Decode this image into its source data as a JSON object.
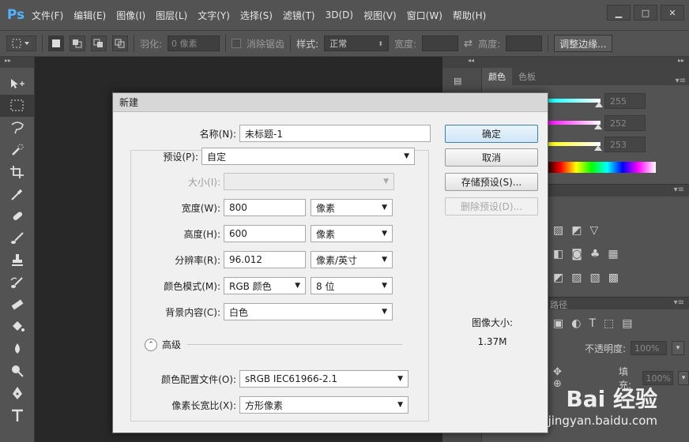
{
  "menubar": {
    "logo": "Ps",
    "items": [
      "文件(F)",
      "编辑(E)",
      "图像(I)",
      "图层(L)",
      "文字(Y)",
      "选择(S)",
      "滤镜(T)",
      "3D(D)",
      "视图(V)",
      "窗口(W)",
      "帮助(H)"
    ],
    "controls": [
      "▁",
      "□",
      "✕"
    ]
  },
  "optionsbar": {
    "feather_label": "羽化:",
    "feather_value": "0 像素",
    "antialias_label": "消除锯齿",
    "style_label": "样式:",
    "style_value": "正常",
    "width_label": "宽度:",
    "height_label": "高度:",
    "refine_edge": "调整边缘..."
  },
  "dialog": {
    "title": "新建",
    "name_label": "名称(N):",
    "name_value": "未标题-1",
    "preset_label": "预设(P):",
    "preset_value": "自定",
    "size_label": "大小(I):",
    "size_value": "",
    "width_label": "宽度(W):",
    "width_value": "800",
    "width_unit": "像素",
    "height_label": "高度(H):",
    "height_value": "600",
    "height_unit": "像素",
    "resolution_label": "分辨率(R):",
    "resolution_value": "96.012",
    "resolution_unit": "像素/英寸",
    "colormode_label": "颜色模式(M):",
    "colormode_value": "RGB 颜色",
    "bitdepth_value": "8 位",
    "bg_label": "背景内容(C):",
    "bg_value": "白色",
    "advanced_label": "高级",
    "profile_label": "颜色配置文件(O):",
    "profile_value": "sRGB IEC61966-2.1",
    "pixel_aspect_label": "像素长宽比(X):",
    "pixel_aspect_value": "方形像素",
    "ok_button": "确定",
    "cancel_button": "取消",
    "save_preset_button": "存储预设(S)...",
    "delete_preset_button": "删除预设(D)...",
    "image_size_label": "图像大小:",
    "image_size_value": "1.37M"
  },
  "panels": {
    "color_tab": "颜色",
    "swatches_tab": "色板",
    "r_value": "255",
    "g_value": "252",
    "b_value": "253",
    "paths_tab": "路径",
    "opacity_label": "不透明度:",
    "opacity_value": "100%",
    "fill_label": "填充:",
    "fill_value": "100%"
  },
  "watermark": {
    "logo": "Bai 经验",
    "url": "jingyan.baidu.com"
  },
  "colors": {
    "ui_dark": "#535353",
    "canvas_bg": "#282828",
    "dialog_bg": "#f0f0f0",
    "ps_blue": "#4fb3ff"
  }
}
